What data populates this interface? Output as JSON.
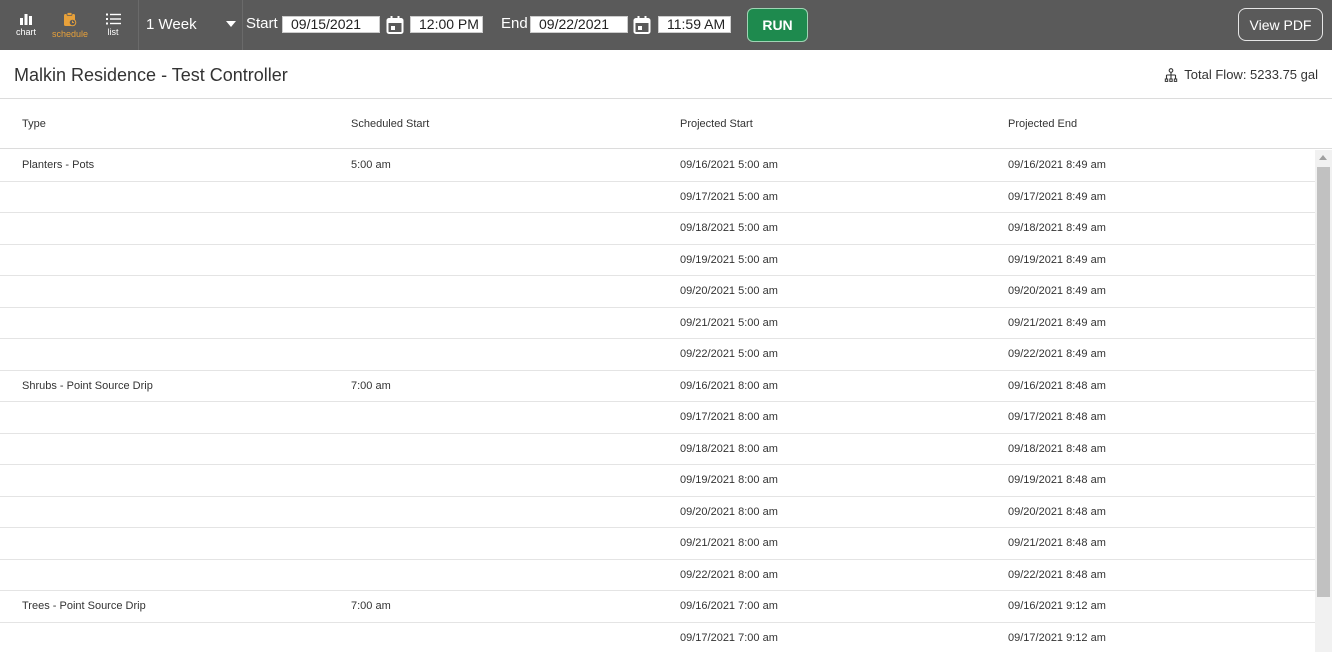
{
  "toolbar": {
    "views": {
      "chart": "chart",
      "schedule": "schedule",
      "list": "list",
      "active": "schedule"
    },
    "range": "1 Week",
    "start_label": "Start",
    "start_date": "09/15/2021",
    "start_time": "12:00 PM",
    "end_label": "End",
    "end_date": "09/22/2021",
    "end_time": "11:59 AM",
    "run_label": "RUN",
    "pdf_label": "View PDF"
  },
  "header": {
    "title": "Malkin Residence - Test Controller",
    "total_flow": "Total Flow: 5233.75 gal"
  },
  "table": {
    "columns": [
      "Type",
      "Scheduled Start",
      "Projected Start",
      "Projected End"
    ],
    "rows": [
      {
        "type": "Planters - Pots",
        "scheduled": "5:00 am",
        "pstart": "09/16/2021 5:00 am",
        "pend": "09/16/2021 8:49 am"
      },
      {
        "type": "",
        "scheduled": "",
        "pstart": "09/17/2021 5:00 am",
        "pend": "09/17/2021 8:49 am"
      },
      {
        "type": "",
        "scheduled": "",
        "pstart": "09/18/2021 5:00 am",
        "pend": "09/18/2021 8:49 am"
      },
      {
        "type": "",
        "scheduled": "",
        "pstart": "09/19/2021 5:00 am",
        "pend": "09/19/2021 8:49 am"
      },
      {
        "type": "",
        "scheduled": "",
        "pstart": "09/20/2021 5:00 am",
        "pend": "09/20/2021 8:49 am"
      },
      {
        "type": "",
        "scheduled": "",
        "pstart": "09/21/2021 5:00 am",
        "pend": "09/21/2021 8:49 am"
      },
      {
        "type": "",
        "scheduled": "",
        "pstart": "09/22/2021 5:00 am",
        "pend": "09/22/2021 8:49 am"
      },
      {
        "type": "Shrubs - Point Source Drip",
        "scheduled": "7:00 am",
        "pstart": "09/16/2021 8:00 am",
        "pend": "09/16/2021 8:48 am"
      },
      {
        "type": "",
        "scheduled": "",
        "pstart": "09/17/2021 8:00 am",
        "pend": "09/17/2021 8:48 am"
      },
      {
        "type": "",
        "scheduled": "",
        "pstart": "09/18/2021 8:00 am",
        "pend": "09/18/2021 8:48 am"
      },
      {
        "type": "",
        "scheduled": "",
        "pstart": "09/19/2021 8:00 am",
        "pend": "09/19/2021 8:48 am"
      },
      {
        "type": "",
        "scheduled": "",
        "pstart": "09/20/2021 8:00 am",
        "pend": "09/20/2021 8:48 am"
      },
      {
        "type": "",
        "scheduled": "",
        "pstart": "09/21/2021 8:00 am",
        "pend": "09/21/2021 8:48 am"
      },
      {
        "type": "",
        "scheduled": "",
        "pstart": "09/22/2021 8:00 am",
        "pend": "09/22/2021 8:48 am"
      },
      {
        "type": "Trees - Point Source Drip",
        "scheduled": "7:00 am",
        "pstart": "09/16/2021 7:00 am",
        "pend": "09/16/2021 9:12 am"
      },
      {
        "type": "",
        "scheduled": "",
        "pstart": "09/17/2021 7:00 am",
        "pend": "09/17/2021 9:12 am"
      }
    ]
  },
  "colors": {
    "toolbar_bg": "#5a5a5a",
    "active_view": "#e8a13a",
    "run_bg": "#1e8a4e"
  }
}
